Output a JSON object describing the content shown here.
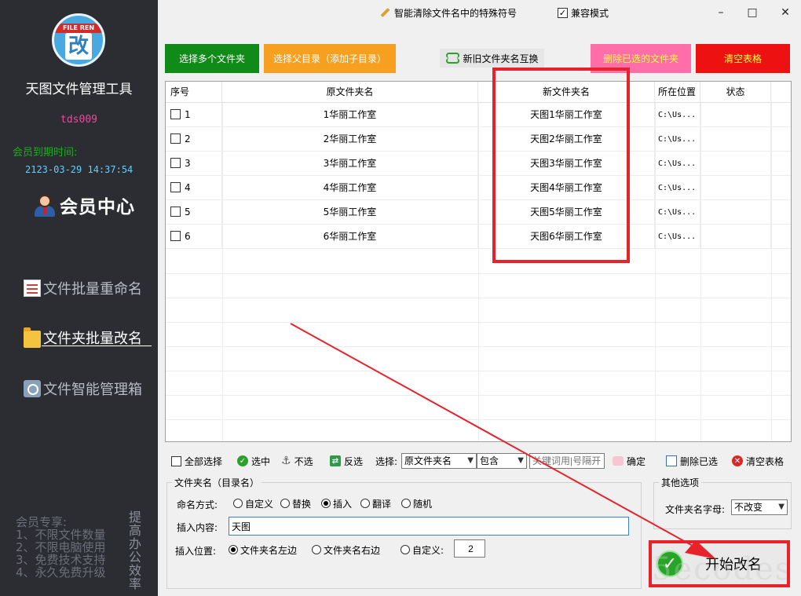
{
  "sidebar": {
    "logo_text": "FILE REN",
    "logo_glyph": "改",
    "app_title": "天图文件管理工具",
    "username": "tds009",
    "expire_label": "会员到期时间:",
    "expire_date": "2123-03-29 14:37:54",
    "member_center": "会员中心",
    "nav": [
      {
        "label": "文件批量重命名",
        "icon": "document-icon",
        "active": false
      },
      {
        "label": "文件夹批量改名",
        "icon": "folder-icon",
        "active": true
      },
      {
        "label": "文件智能管理箱",
        "icon": "toolbox-icon",
        "active": false
      }
    ],
    "perks_title": "会员专享:",
    "perks": [
      "1、不限文件数量",
      "2、不限电脑使用",
      "3、免费技术支持",
      "4、永久免费升级"
    ],
    "vertical_slogan": "提高办公效率"
  },
  "topbar": {
    "clean_special_chars": "智能清除文件名中的特殊符号",
    "compat_mode": "兼容模式",
    "compat_checked": true
  },
  "toolbar": {
    "select_folders": "选择多个文件夹",
    "select_parent": "选择父目录（添加子目录）",
    "swap_names": "新旧文件夹名互换",
    "delete_selected": "删除已选的文件夹",
    "clear_table": "清空表格"
  },
  "table": {
    "headers": [
      "序号",
      "原文件夹名",
      "新文件夹名",
      "所在位置",
      "状态"
    ],
    "rows": [
      {
        "idx": "1",
        "old": "1华丽工作室",
        "new": "天图1华丽工作室",
        "loc": "C:\\Us...",
        "status": ""
      },
      {
        "idx": "2",
        "old": "2华丽工作室",
        "new": "天图2华丽工作室",
        "loc": "C:\\Us...",
        "status": ""
      },
      {
        "idx": "3",
        "old": "3华丽工作室",
        "new": "天图3华丽工作室",
        "loc": "C:\\Us...",
        "status": ""
      },
      {
        "idx": "4",
        "old": "4华丽工作室",
        "new": "天图4华丽工作室",
        "loc": "C:\\Us...",
        "status": ""
      },
      {
        "idx": "5",
        "old": "5华丽工作室",
        "new": "天图5华丽工作室",
        "loc": "C:\\Us...",
        "status": ""
      },
      {
        "idx": "6",
        "old": "6华丽工作室",
        "new": "天图6华丽工作室",
        "loc": "C:\\Us...",
        "status": ""
      }
    ]
  },
  "actionbar": {
    "select_all": "全部选择",
    "check": "选中",
    "uncheck": "不选",
    "invert": "反选",
    "select_label": "选择:",
    "field_value": "原文件夹名",
    "match_value": "包含",
    "keyword_placeholder": "关键词用|号隔开",
    "confirm": "确定",
    "delete_selected": "删除已选",
    "clear_table": "清空表格"
  },
  "naming": {
    "group_title": "文件夹名（目录名）",
    "mode_label": "命名方式:",
    "modes": [
      {
        "label": "自定义",
        "on": false
      },
      {
        "label": "替换",
        "on": false
      },
      {
        "label": "插入",
        "on": true
      },
      {
        "label": "翻译",
        "on": false
      },
      {
        "label": "随机",
        "on": false
      }
    ],
    "insert_content_label": "插入内容:",
    "insert_content_value": "天图",
    "insert_pos_label": "插入位置:",
    "positions": [
      {
        "label": "文件夹名左边",
        "on": true
      },
      {
        "label": "文件夹名右边",
        "on": false
      },
      {
        "label": "自定义:",
        "on": false
      }
    ],
    "custom_pos_value": "2"
  },
  "other": {
    "group_title": "其他选项",
    "case_label": "文件夹名字母:",
    "case_value": "不改变"
  },
  "start_button": "开始改名",
  "watermark": "5ecodes"
}
